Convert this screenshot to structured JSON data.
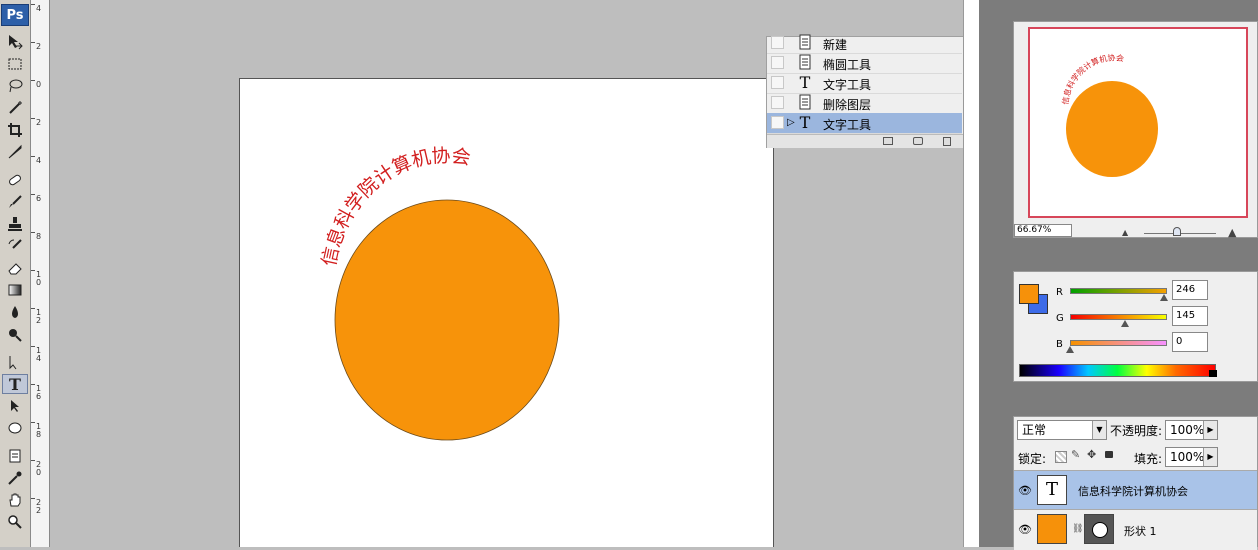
{
  "toolbox": {
    "logo": "Ps",
    "tools": [
      "move-tool",
      "marquee-tool",
      "lasso-tool",
      "magic-wand-tool",
      "crop-tool",
      "slice-tool",
      "healing-brush-tool",
      "brush-tool",
      "clone-stamp-tool",
      "history-brush-tool",
      "eraser-tool",
      "gradient-tool",
      "blur-tool",
      "dodge-tool",
      "path-selection-tool",
      "type-tool",
      "direct-selection-tool",
      "ellipse-tool",
      "notes-tool",
      "eyedropper-tool",
      "hand-tool",
      "zoom-tool"
    ],
    "selected_tool": "type-tool"
  },
  "ruler": {
    "labels": [
      "4",
      "2",
      "0",
      "2",
      "4",
      "6",
      "8",
      "1\n0",
      "1\n2",
      "1\n4",
      "1\n6",
      "1\n8",
      "2\n0",
      "2\n2"
    ]
  },
  "document": {
    "arc_text": "信息科学院计算机协会",
    "arc_text_color": "#d21f1f",
    "circle_color": "#f7930a"
  },
  "history": {
    "items": [
      {
        "label": "新建",
        "icon": "document-icon",
        "selected": false
      },
      {
        "label": "椭圆工具",
        "icon": "document-icon",
        "selected": false
      },
      {
        "label": "文字工具",
        "icon": "type-icon",
        "selected": false
      },
      {
        "label": "删除图层",
        "icon": "document-icon",
        "selected": false
      },
      {
        "label": "文字工具",
        "icon": "type-icon",
        "selected": true
      }
    ]
  },
  "navigator": {
    "zoom": "66.67%",
    "frame_color": "#d7465a"
  },
  "color": {
    "foreground": "#f6910a",
    "background": "#3d6be8",
    "channels": [
      {
        "label": "R",
        "value": "246",
        "fraction": 0.965
      },
      {
        "label": "G",
        "value": "145",
        "fraction": 0.569
      },
      {
        "label": "B",
        "value": "0",
        "fraction": 0.0
      }
    ]
  },
  "layers": {
    "blend_mode": "正常",
    "opacity_label": "不透明度:",
    "opacity_value": "100%",
    "lock_label": "锁定:",
    "fill_label": "填充:",
    "fill_value": "100%",
    "items": [
      {
        "name": "信息科学院计算机协会",
        "thumb": "T",
        "selected": true
      },
      {
        "name": "形状 1",
        "selected": false
      }
    ]
  }
}
